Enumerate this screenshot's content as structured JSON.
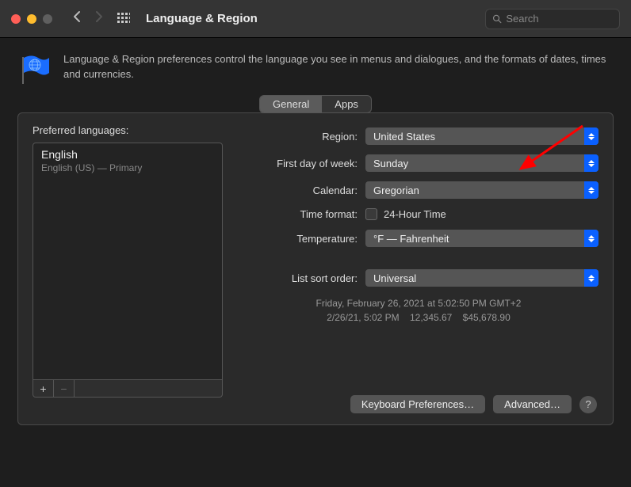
{
  "window": {
    "title": "Language & Region"
  },
  "search": {
    "placeholder": "Search"
  },
  "intro": {
    "text": "Language & Region preferences control the language you see in menus and dialogues, and the formats of dates, times and currencies."
  },
  "tabs": {
    "general": "General",
    "apps": "Apps"
  },
  "left": {
    "heading": "Preferred languages:",
    "lang_name": "English",
    "lang_sub": "English (US) — Primary"
  },
  "rows": {
    "region_label": "Region:",
    "region_value": "United States",
    "firstday_label": "First day of week:",
    "firstday_value": "Sunday",
    "calendar_label": "Calendar:",
    "calendar_value": "Gregorian",
    "timeformat_label": "Time format:",
    "timeformat_option": "24-Hour Time",
    "temperature_label": "Temperature:",
    "temperature_value": "°F — Fahrenheit",
    "listsort_label": "List sort order:",
    "listsort_value": "Universal"
  },
  "sample": {
    "line1": "Friday, February 26, 2021 at 5:02:50 PM GMT+2",
    "line2": "2/26/21, 5:02 PM    12,345.67    $45,678.90"
  },
  "buttons": {
    "keyboard": "Keyboard Preferences…",
    "advanced": "Advanced…"
  }
}
